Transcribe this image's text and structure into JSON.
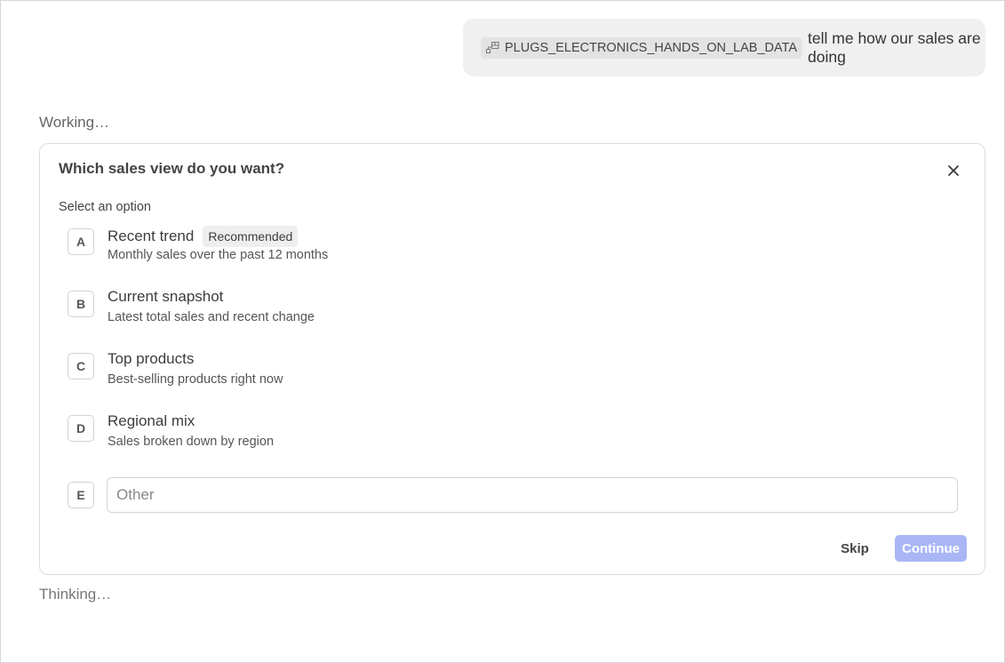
{
  "user_message": {
    "data_source": "PLUGS_ELECTRONICS_HANDS_ON_LAB_DATA",
    "data_source_icon": "database-icon",
    "text": "tell me how our sales are doing"
  },
  "status": {
    "working": "Working…",
    "thinking": "Thinking…"
  },
  "question": {
    "title": "Which sales view do you want?",
    "close_icon": "close-icon",
    "select_label": "Select an option",
    "options": [
      {
        "key": "A",
        "title": "Recent trend",
        "badge": "Recommended",
        "description": "Monthly sales over the past 12 months"
      },
      {
        "key": "B",
        "title": "Current snapshot",
        "description": "Latest total sales and recent change"
      },
      {
        "key": "C",
        "title": "Top products",
        "description": "Best-selling products right now"
      },
      {
        "key": "D",
        "title": "Regional mix",
        "description": "Sales broken down by region"
      }
    ],
    "other": {
      "key": "E",
      "placeholder": "Other",
      "value": ""
    },
    "skip_label": "Skip",
    "continue_label": "Continue"
  },
  "colors": {
    "continue_disabled": "#a9b6f5",
    "bubble_bg": "#f0f0f0",
    "badge_bg": "#eeeeee"
  }
}
